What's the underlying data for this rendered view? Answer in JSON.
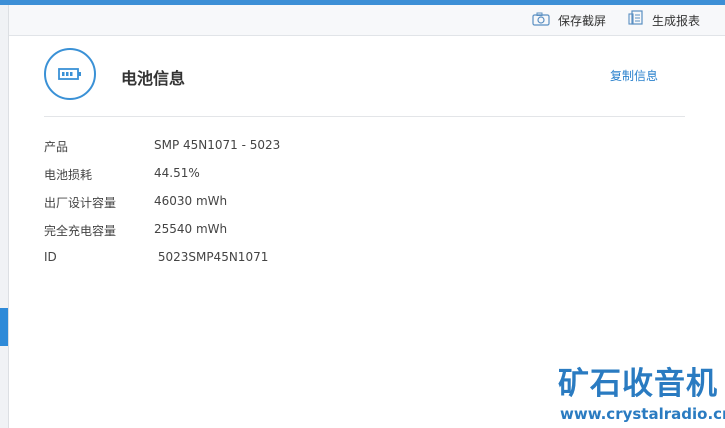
{
  "toolbar": {
    "screenshot_label": "保存截屏",
    "report_label": "生成报表",
    "screenshot_icon": "camera-icon",
    "report_icon": "report-icon"
  },
  "header": {
    "title": "电池信息",
    "copy_label": "复制信息",
    "icon": "battery-icon"
  },
  "battery_info": [
    {
      "label": "产品",
      "value": "SMP 45N1071 -  5023"
    },
    {
      "label": "电池损耗",
      "value": "44.51%"
    },
    {
      "label": "出厂设计容量",
      "value": "46030 mWh"
    },
    {
      "label": "完全充电容量",
      "value": "25540 mWh"
    },
    {
      "label": "ID",
      "value": " 5023SMP45N1071"
    }
  ],
  "watermark": {
    "text_cn": "矿石收音机",
    "url": "www.crystalradio.cn"
  },
  "colors": {
    "accent": "#3a91d6",
    "link": "#2b82cd",
    "watermark": "#2a7bc1"
  }
}
